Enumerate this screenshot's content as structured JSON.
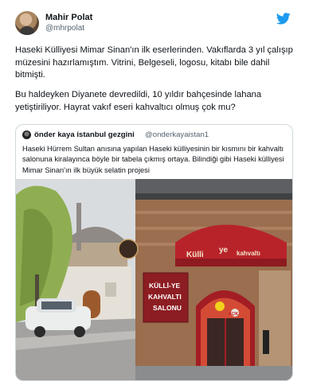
{
  "tweet": {
    "author": {
      "display_name": "Mahir Polat",
      "handle": "@mhrpolat",
      "avatar_icon": "user-avatar"
    },
    "brand_icon": "twitter-bird-icon",
    "brand_color": "#1d9bf0",
    "paragraphs": [
      "Haseki Külliyesi Mimar Sinan'ın ilk eserlerinden. Vakıflarda 3 yıl çalışıp müzesini hazırlamıştım. Vitrini, Belgeseli, logosu, kitabı bile dahil bitmişti.",
      "Bu haldeyken Diyanete devredildi, 10 yıldır bahçesinde lahana yetiştiriliyor. Hayrat vakıf eseri kahvaltıcı olmuş çok mu?"
    ]
  },
  "quoted_tweet": {
    "author_name": "önder kaya istanbul gezgini",
    "author_handle": "@onderkayaistan1",
    "text": "Haseki Hürrem Sultan anısına yapılan Haseki külliyesinin bir kısmını bir kahvaltı salonuna kiralayınca böyle bir tabela çıkmış ortaya. Bilindiği gibi Haseki külliyesi Mimar Sinan'ın ilk büyük selatin projesi",
    "photo": {
      "sign_line1": "KÜLLİ-YE",
      "sign_line2": "KAHVALTI",
      "sign_line3": "SALONU",
      "awning_text_left": "Külli",
      "awning_text_mid": "ye",
      "awning_text_right": "kahvaltı",
      "door_sign": "AÇIK"
    }
  }
}
